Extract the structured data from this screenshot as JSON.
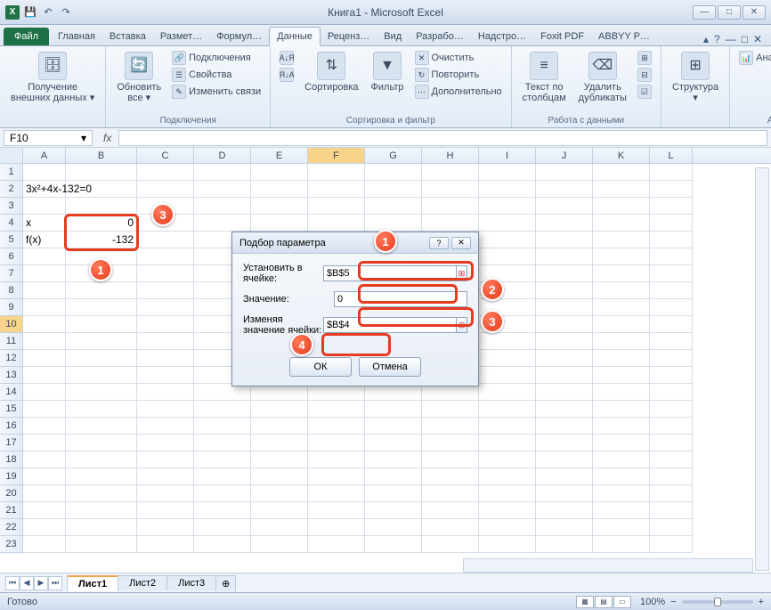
{
  "app": {
    "title": "Книга1  -  Microsoft Excel",
    "excel_letter": "X"
  },
  "qat": {
    "save": "💾",
    "undo": "↶",
    "redo": "↷"
  },
  "win": {
    "min": "—",
    "max": "□",
    "close": "✕",
    "wmin": "—",
    "wmax": "□",
    "wclose": "✕"
  },
  "tabs": {
    "file": "Файл",
    "items": [
      "Главная",
      "Вставка",
      "Размет…",
      "Формул…",
      "Данные",
      "Реценз…",
      "Вид",
      "Разрабо…",
      "Надстро…",
      "Foxit PDF",
      "ABBYY P…"
    ],
    "active_index": 4
  },
  "help": {
    "q": "?",
    "up": "▴"
  },
  "ribbon": {
    "g1": {
      "btn": "Получение\nвнешних данных ▾",
      "label": ""
    },
    "g2": {
      "btn": "Обновить\nвсе ▾",
      "s1": "Подключения",
      "s2": "Свойства",
      "s3": "Изменить связи",
      "label": "Подключения"
    },
    "g3": {
      "az": "А↓Я",
      "za": "Я↓А",
      "sort": "Сортировка",
      "filter": "Фильтр",
      "c1": "Очистить",
      "c2": "Повторить",
      "c3": "Дополнительно",
      "label": "Сортировка и фильтр"
    },
    "g4": {
      "b1": "Текст по\nстолбцам",
      "b2": "Удалить\nдубликаты",
      "s1": "⊞",
      "s2": "⊟",
      "s3": "☑",
      "label": "Работа с данными"
    },
    "g5": {
      "btn": "Структура\n▾",
      "label": ""
    },
    "g6": {
      "btn": "Анализ данных",
      "label": "Анализ"
    }
  },
  "fbar": {
    "name": "F10",
    "drop": "▾",
    "fx": "fx",
    "formula": ""
  },
  "cols": [
    "A",
    "B",
    "C",
    "D",
    "E",
    "F",
    "G",
    "H",
    "I",
    "J",
    "K",
    "L"
  ],
  "rows_count": 23,
  "cells": {
    "A2": "3x²+4x-132=0",
    "A4": "x",
    "B4": "0",
    "A5": "f(x)",
    "B5": "-132"
  },
  "active_cell": "F10",
  "sheets": {
    "nav": [
      "⏮",
      "◀",
      "▶",
      "⏭"
    ],
    "tabs": [
      "Лист1",
      "Лист2",
      "Лист3"
    ],
    "new": "⊕",
    "active": 0
  },
  "status": {
    "ready": "Готово",
    "zoom": "100%",
    "minus": "−",
    "plus": "+"
  },
  "dialog": {
    "title": "Подбор параметра",
    "help": "?",
    "close": "✕",
    "l1": "Установить в ячейке:",
    "v1": "$B$5",
    "l2": "Значение:",
    "v2": "0",
    "l3": "Изменяя значение ячейки:",
    "v3": "$B$4",
    "ref": "⊞",
    "ok": "ОК",
    "cancel": "Отмена"
  },
  "callouts": {
    "c1": "1",
    "c2": "2",
    "c3": "3",
    "c4": "4",
    "c5": "1",
    "c6": "3"
  }
}
